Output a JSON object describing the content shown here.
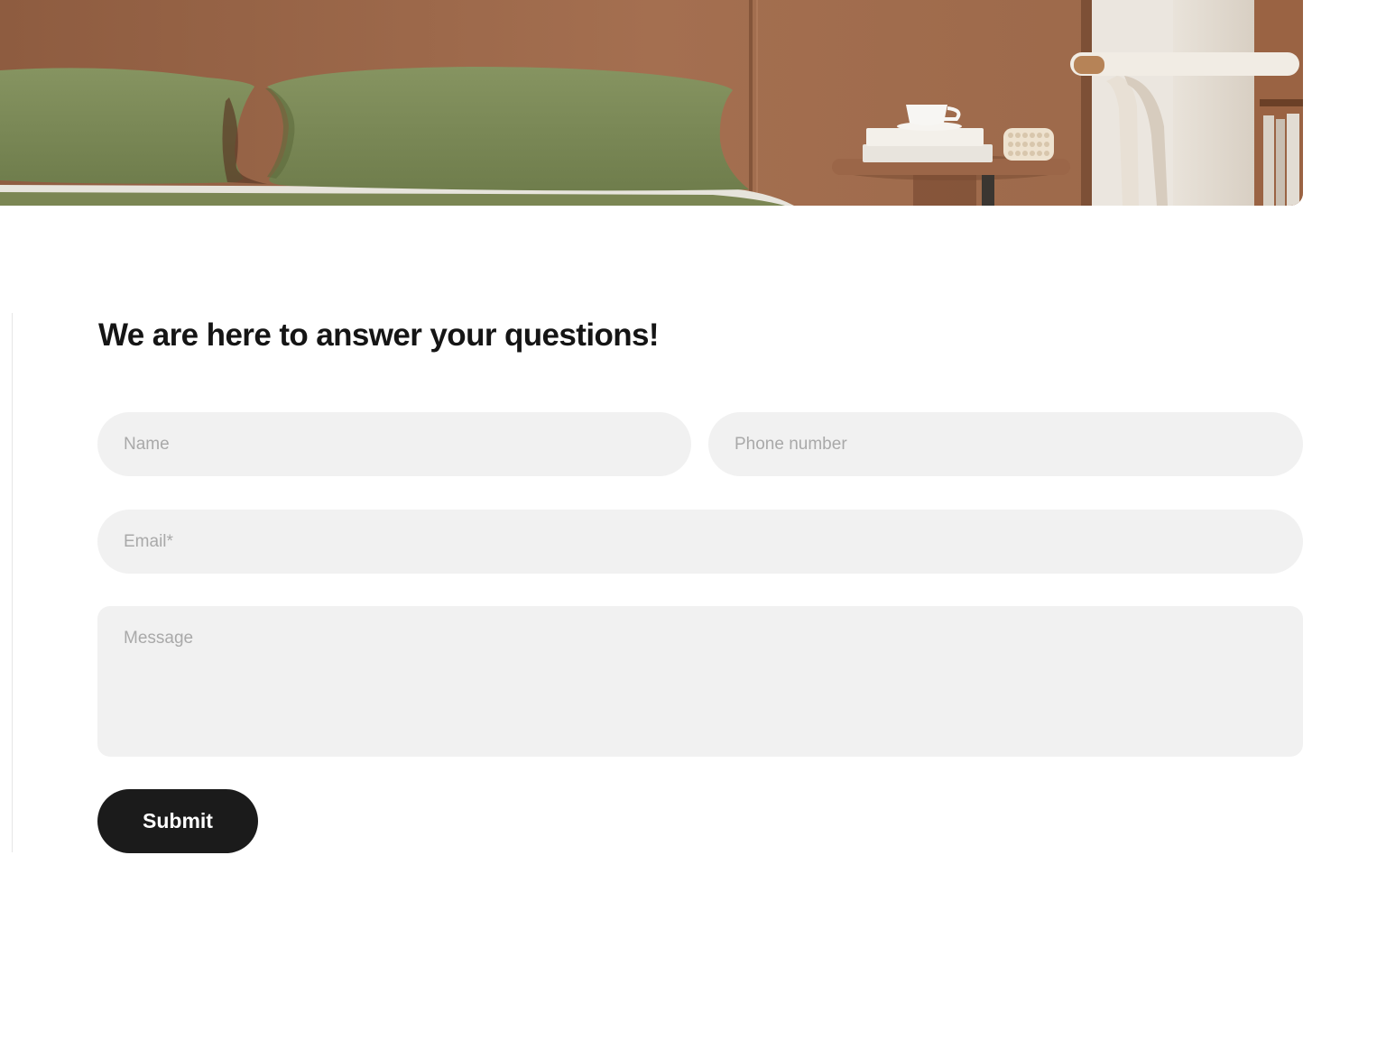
{
  "form": {
    "heading": "We are here to answer your questions!",
    "name_placeholder": "Name",
    "phone_placeholder": "Phone number",
    "email_placeholder": "Email*",
    "message_placeholder": "Message",
    "submit_label": "Submit"
  },
  "colors": {
    "field_background": "#f1f1f1",
    "button_background": "#1b1b1b",
    "heading_text": "#151515",
    "placeholder_text": "#a9a9a9"
  }
}
